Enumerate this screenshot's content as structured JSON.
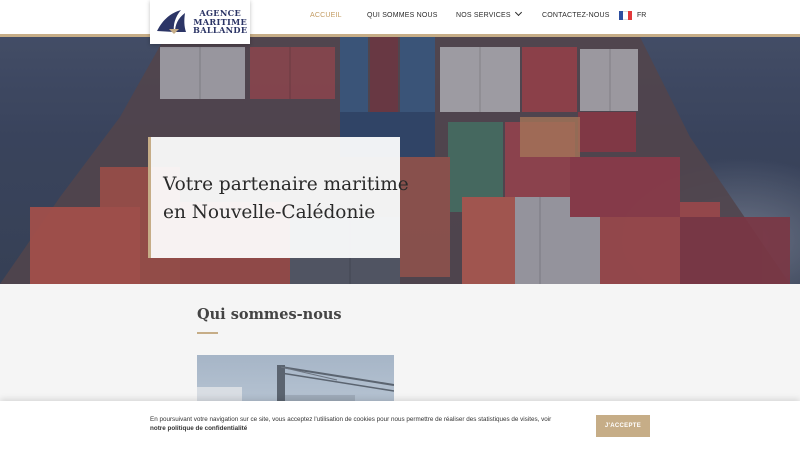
{
  "logo": {
    "line1": "AGENCE",
    "line2": "MARITIME",
    "line3": "BALLANDE",
    "icon": "sail-logo-icon"
  },
  "nav": {
    "items": [
      {
        "label": "ACCUEIL",
        "active": true
      },
      {
        "label": "QUI SOMMES NOUS",
        "active": false
      },
      {
        "label": "NOS SERVICES",
        "active": false,
        "has_dropdown": true
      },
      {
        "label": "CONTACTEZ-NOUS",
        "active": false
      }
    ],
    "language": "FR",
    "flag_icon": "france-flag-icon"
  },
  "hero": {
    "title_line1": "Votre partenaire maritime",
    "title_line2": "en Nouvelle-Calédonie"
  },
  "section": {
    "title": "Qui sommes-nous"
  },
  "cookie": {
    "message": "En poursuivant votre navigation sur ce site, vous acceptez l'utilisation de cookies pour nous permettre de réaliser des statistiques de visites, voir",
    "link": "notre politique de confidentialité",
    "accept": "J'ACCEPTE"
  },
  "colors": {
    "accent_gold": "#c6ad87",
    "active_nav": "#c39b62",
    "logo_navy": "#2c3566"
  }
}
